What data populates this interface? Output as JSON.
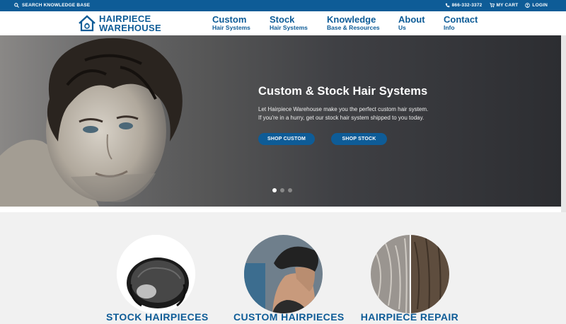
{
  "topbar": {
    "search_label": "SEARCH KNOWLEDGE BASE",
    "phone": "866-332-3372",
    "cart": "MY CART",
    "login": "LOGIN"
  },
  "logo": {
    "line1": "HAIRPIECE",
    "line2": "WAREHOUSE"
  },
  "nav": {
    "items": [
      {
        "title": "Custom",
        "sub": "Hair Systems"
      },
      {
        "title": "Stock",
        "sub": "Hair Systems"
      },
      {
        "title": "Knowledge",
        "sub": "Base & Resources"
      },
      {
        "title": "About",
        "sub": "Us"
      },
      {
        "title": "Contact",
        "sub": "Info"
      }
    ]
  },
  "hero": {
    "title": "Custom & Stock Hair Systems",
    "desc_line1": "Let Hairpiece Warehouse make you the perfect custom hair system.",
    "desc_line2": "If you're in a hurry, get our stock hair system shipped to you today.",
    "btn1": "SHOP CUSTOM",
    "btn2": "SHOP STOCK",
    "slides": 3,
    "active_slide": 1
  },
  "categories": [
    {
      "label": "STOCK HAIRPIECES"
    },
    {
      "label": "CUSTOM HAIRPIECES"
    },
    {
      "label": "HAIRPIECE REPAIR"
    }
  ],
  "colors": {
    "brand": "#0e5c97",
    "section_bg": "#f1f1f1"
  }
}
